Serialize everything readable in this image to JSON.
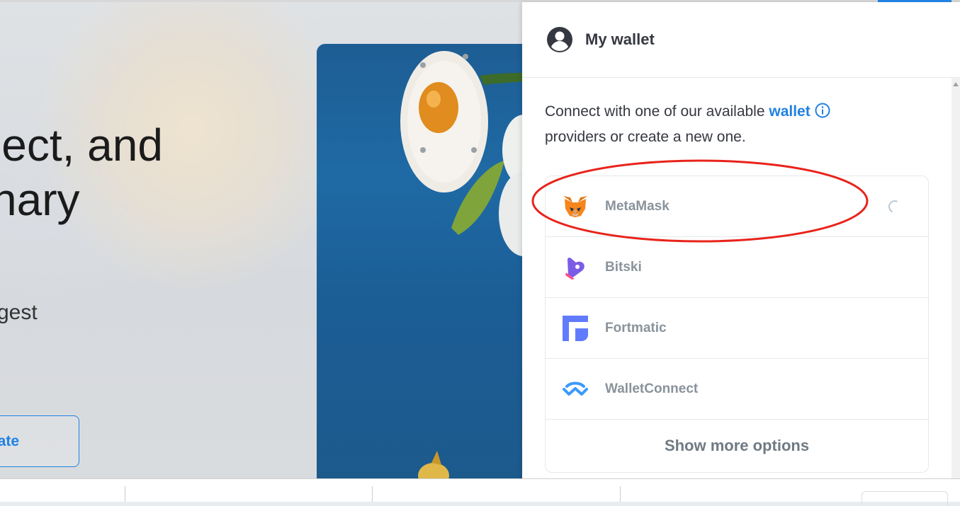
{
  "hero": {
    "headline_line1": "lect, and",
    "headline_line2": "nary",
    "subtext": "gest",
    "button_label": "ate"
  },
  "wallet_panel": {
    "title": "My wallet",
    "intro_before": "Connect with one of our available ",
    "intro_link": "wallet",
    "intro_after": "providers or create a new one.",
    "providers": [
      {
        "name": "MetaMask",
        "icon": "metamask-fox-icon",
        "loading": true
      },
      {
        "name": "Bitski",
        "icon": "bitski-icon"
      },
      {
        "name": "Fortmatic",
        "icon": "fortmatic-icon"
      },
      {
        "name": "WalletConnect",
        "icon": "walletconnect-icon"
      }
    ],
    "show_more_label": "Show more options"
  },
  "colors": {
    "accent": "#2081e2",
    "annotation": "#e8231b",
    "provider_text": "#8a939b"
  }
}
